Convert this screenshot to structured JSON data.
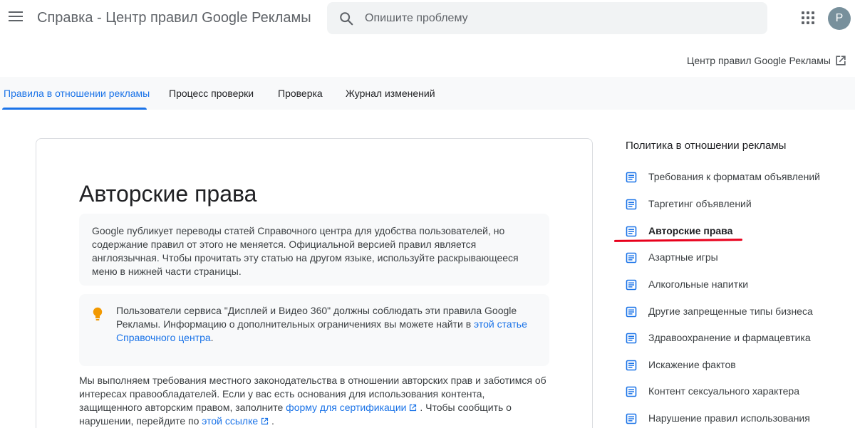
{
  "header": {
    "title": "Справка - Центр правил Google Рекламы",
    "search_placeholder": "Опишите проблему",
    "avatar_letter": "P"
  },
  "external_link": "Центр правил Google Рекламы",
  "tabs": [
    {
      "label": "Правила в отношении рекламы"
    },
    {
      "label": "Процесс проверки"
    },
    {
      "label": "Проверка"
    },
    {
      "label": "Журнал изменений"
    }
  ],
  "article": {
    "title": "Авторские права",
    "note1": "Google публикует переводы статей Справочного центра для удобства пользователей, но содержание правил от этого не меняется. Официальной версией правил является англоязычная. Чтобы прочитать эту статью на другом языке, используйте раскрывающееся меню в нижней части страницы.",
    "note2_text": "Пользователи сервиса \"Дисплей и Видео 360\" должны соблюдать эти правила Google Рекламы. Информацию о дополнительных ограничениях вы можете найти в ",
    "note2_link": "этой статье Справочного центра",
    "note2_end": ".",
    "body_part1": "Мы выполняем требования местного законодательства в отношении авторских прав и заботимся об интересах правообладателей. Если у вас есть основания для использования контента, защищенного авторским правом, заполните ",
    "body_link1": "форму для сертификации",
    "body_part2": " . Чтобы сообщить о нарушении, перейдите по ",
    "body_link2": "этой ссылке",
    "body_part3": " ."
  },
  "sidebar": {
    "title": "Политика в отношении рекламы",
    "items": [
      {
        "label": "Требования к форматам объявлений"
      },
      {
        "label": "Таргетинг объявлений"
      },
      {
        "label": "Авторские права"
      },
      {
        "label": "Азартные игры"
      },
      {
        "label": "Алкогольные напитки"
      },
      {
        "label": "Другие запрещенные типы бизнеса"
      },
      {
        "label": "Здравоохранение и фармацевтика"
      },
      {
        "label": "Искажение фактов"
      },
      {
        "label": "Контент сексуального характера"
      },
      {
        "label": "Нарушение правил использования"
      }
    ]
  },
  "colors": {
    "accent": "#1a73e8",
    "annotation_red": "#e8001c",
    "bulb": "#f29900"
  }
}
